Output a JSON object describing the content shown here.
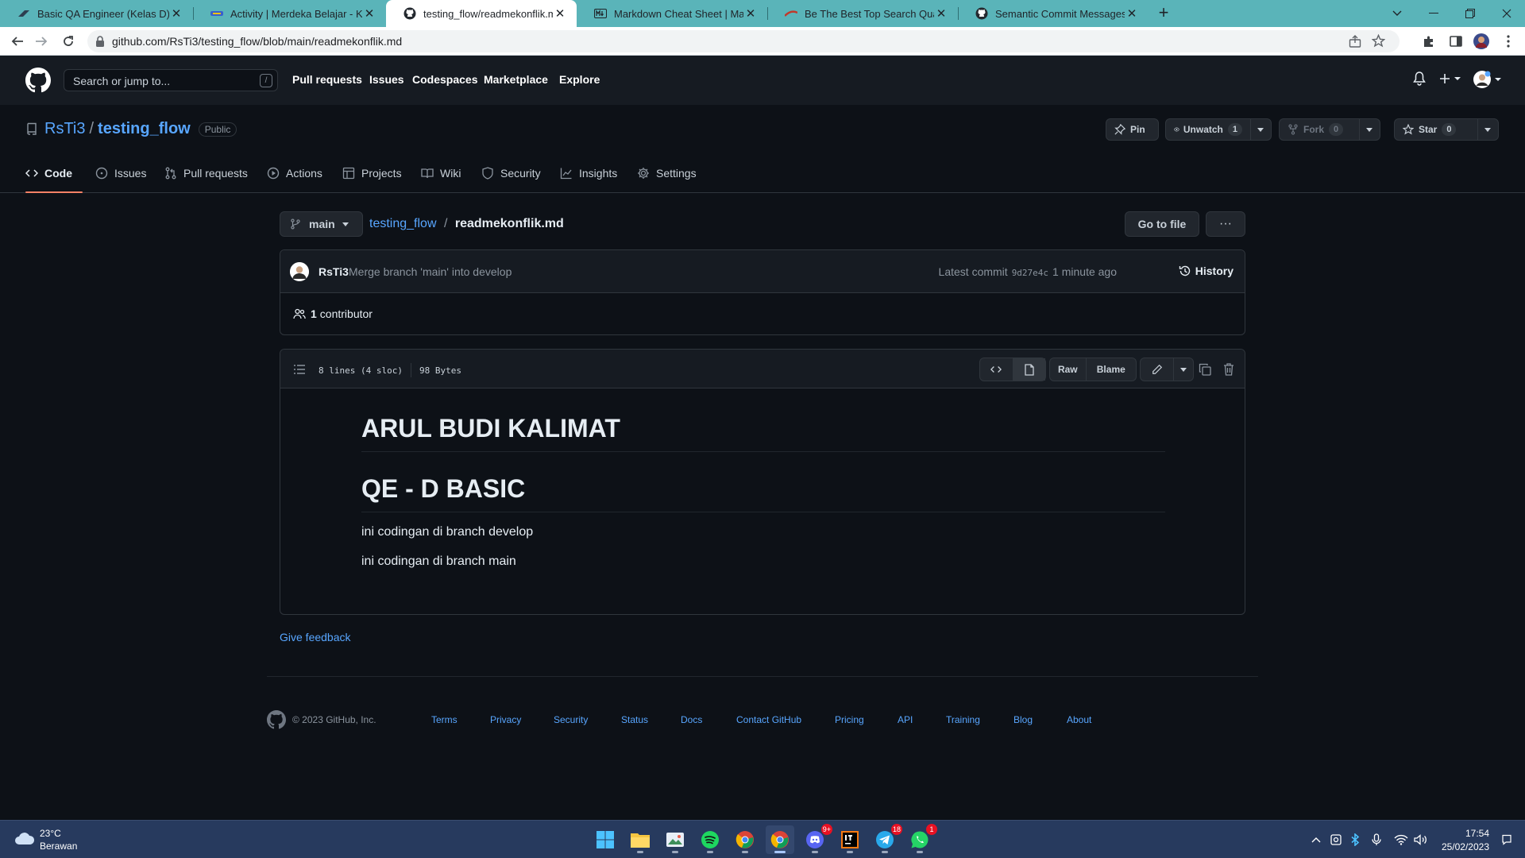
{
  "browser": {
    "tabs": [
      {
        "title": "Basic QA Engineer (Kelas D)",
        "active": false
      },
      {
        "title": "Activity | Merdeka Belajar - Kamp",
        "active": false
      },
      {
        "title": "testing_flow/readmekonflik.md a",
        "active": true
      },
      {
        "title": "Markdown Cheat Sheet | Markdo",
        "active": false
      },
      {
        "title": "Be The Best Top Search Quality E",
        "active": false
      },
      {
        "title": "Semantic Commit Messages",
        "active": false
      }
    ],
    "url": "github.com/RsTi3/testing_flow/blob/main/readmekonflik.md"
  },
  "github": {
    "search_placeholder": "Search or jump to...",
    "search_shortcut": "/",
    "nav": [
      "Pull requests",
      "Issues",
      "Codespaces",
      "Marketplace",
      "Explore"
    ]
  },
  "repo": {
    "owner": "RsTi3",
    "separator": "/",
    "name": "testing_flow",
    "visibility": "Public",
    "actions": {
      "pin": "Pin",
      "unwatch": "Unwatch",
      "watch_count": "1",
      "fork": "Fork",
      "fork_count": "0",
      "star": "Star",
      "star_count": "0"
    },
    "tabs": [
      "Code",
      "Issues",
      "Pull requests",
      "Actions",
      "Projects",
      "Wiki",
      "Security",
      "Insights",
      "Settings"
    ],
    "active_tab": "Code"
  },
  "file": {
    "branch": "main",
    "breadcrumb_repo": "testing_flow",
    "breadcrumb_sep": "/",
    "breadcrumb_file": "readmekonflik.md",
    "go_to_file": "Go to file",
    "more": "···",
    "commit": {
      "author": "RsTi3",
      "message": "Merge branch 'main' into develop",
      "latest_label": "Latest commit",
      "sha": "9d27e4c",
      "time": "1 minute ago",
      "history": "History"
    },
    "contributors_count": "1",
    "contributors_label": "contributor",
    "lines": "8 lines (4 sloc)",
    "size": "98 Bytes",
    "raw": "Raw",
    "blame": "Blame",
    "content": {
      "h1_a": "ARUL BUDI KALIMAT",
      "h1_b": "QE - D BASIC",
      "p_a": "ini codingan di branch develop",
      "p_b": "ini codingan di branch main"
    },
    "feedback": "Give feedback"
  },
  "footer": {
    "copyright": "© 2023 GitHub, Inc.",
    "links": [
      "Terms",
      "Privacy",
      "Security",
      "Status",
      "Docs",
      "Contact GitHub",
      "Pricing",
      "API",
      "Training",
      "Blog",
      "About"
    ]
  },
  "taskbar": {
    "temperature": "23°C",
    "weather": "Berawan",
    "discord_badge": "9+",
    "telegram_badge": "18",
    "whatsapp_badge": "1",
    "time": "17:54",
    "date": "25/02/2023"
  },
  "colors": {
    "github_bg": "#0d1117",
    "header_bg": "#161b22",
    "link": "#58a6ff",
    "tab_underline": "#f78166",
    "browser_accent": "#5ab4b9",
    "taskbar_bg": "#273a5e"
  }
}
